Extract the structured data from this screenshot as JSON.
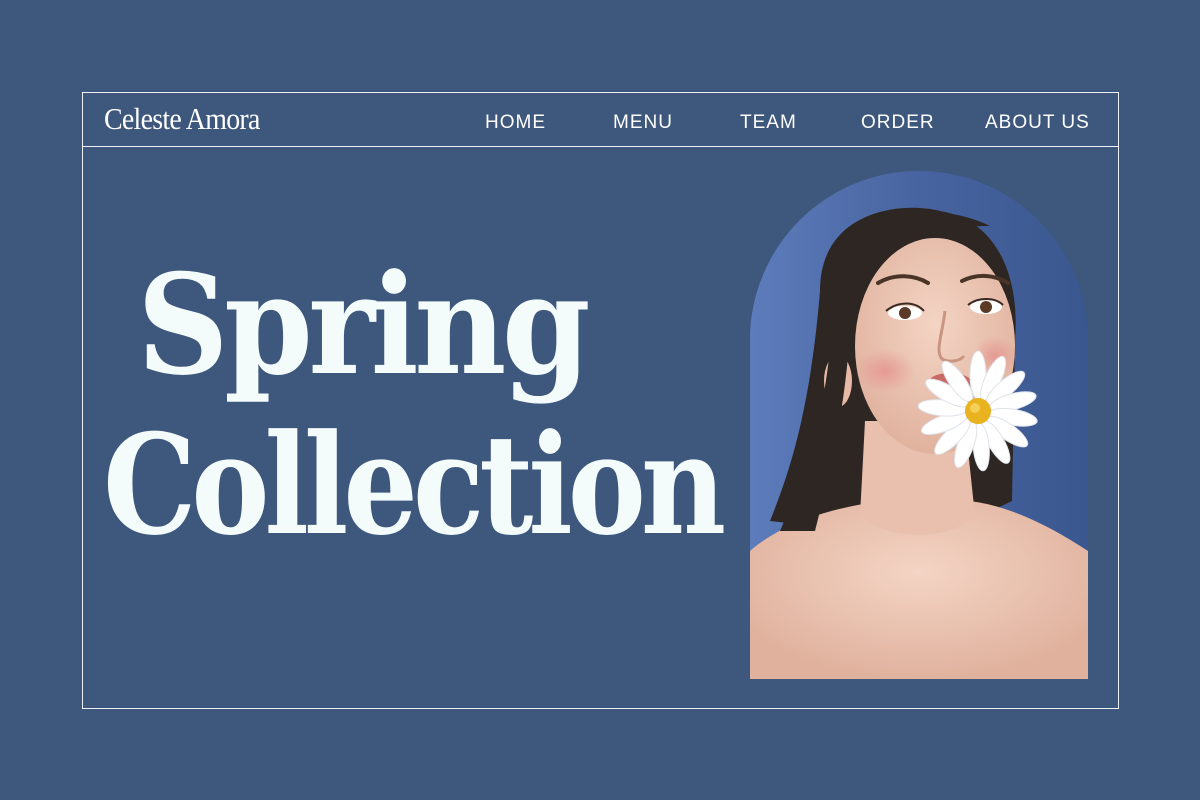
{
  "brand": {
    "name": "Celeste Amora"
  },
  "nav": {
    "items": [
      "HOME",
      "MENU",
      "TEAM",
      "ORDER",
      "ABOUT US"
    ]
  },
  "hero": {
    "line1": "Spring",
    "line2": "Collection"
  },
  "photo": {
    "subject": "woman-with-daisy-portrait"
  },
  "colors": {
    "background": "#3d577d",
    "frame_line": "#eef2f8",
    "title_text": "#f3fbfb",
    "photo_backdrop": "#4a67a3"
  }
}
